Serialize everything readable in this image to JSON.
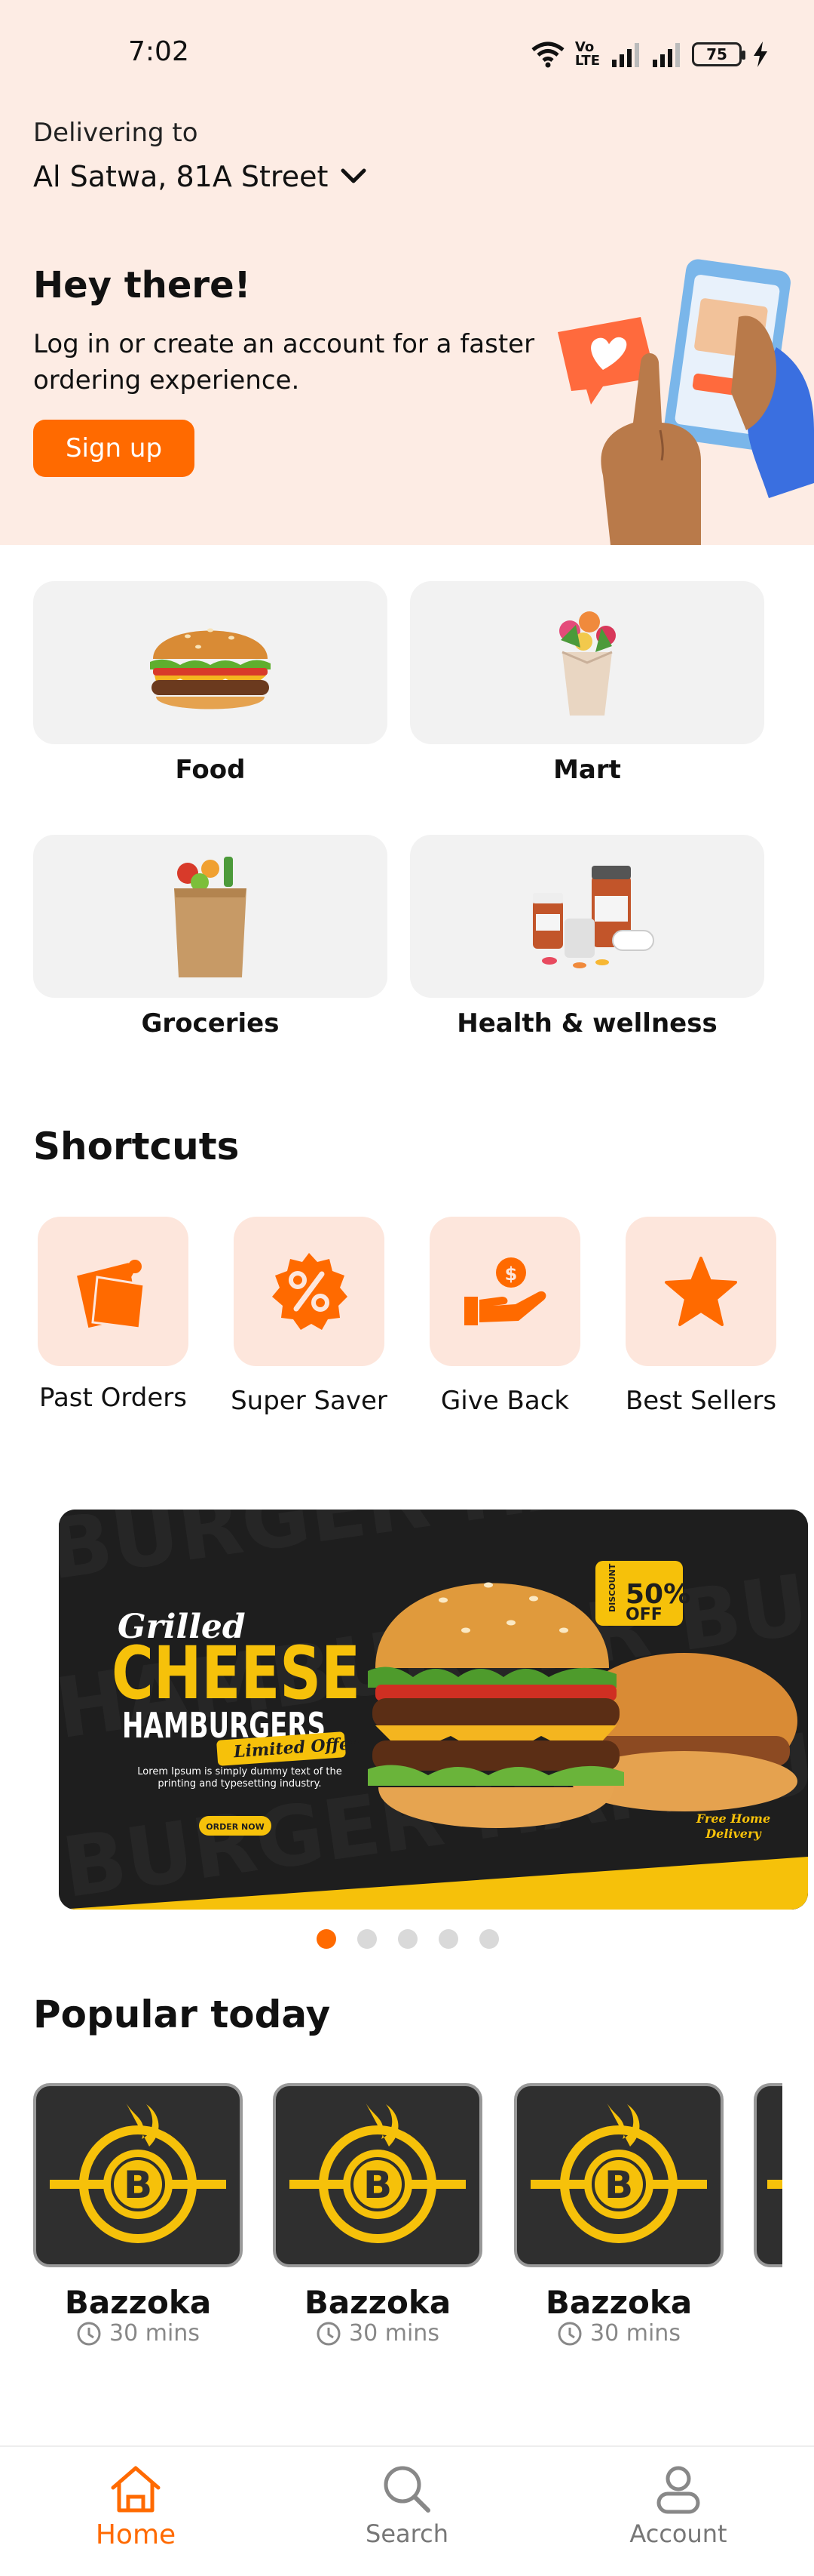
{
  "status_bar": {
    "time": "7:02",
    "network_label": "Vo\nLTE",
    "battery": "75"
  },
  "header": {
    "delivering_label": "Delivering to",
    "location": "Al Satwa, 81A Street"
  },
  "hero": {
    "greeting": "Hey there!",
    "subtitle": "Log in or create an account for a faster ordering experience.",
    "signup_label": "Sign up"
  },
  "categories": [
    {
      "label": "Food",
      "icon": "burger-icon"
    },
    {
      "label": "Mart",
      "icon": "bouquet-icon"
    },
    {
      "label": "Groceries",
      "icon": "grocery-bag-icon"
    },
    {
      "label": "Health & wellness",
      "icon": "medicine-icon"
    }
  ],
  "shortcuts": {
    "title": "Shortcuts",
    "items": [
      {
        "label": "Past Orders",
        "icon": "pinned-note-icon"
      },
      {
        "label": "Super Saver",
        "icon": "discount-badge-icon"
      },
      {
        "label": "Give Back",
        "icon": "donate-hand-icon"
      },
      {
        "label": "Best Sellers",
        "icon": "star-icon"
      }
    ]
  },
  "banner": {
    "script_title": "Grilled",
    "title_main": "CHEESE",
    "title_sub": "HAMBURGERS",
    "ribbon": "Limited Offer",
    "body": "Lorem Ipsum is simply dummy text of the printing and typesetting industry.",
    "cta": "ORDER NOW",
    "offer_value": "50%",
    "offer_unit": "OFF",
    "offer_prefix": "DISCOUNT",
    "delivery_note": "Free Home Delivery",
    "slide_count": 5,
    "active_slide": 1
  },
  "popular": {
    "title": "Popular today",
    "items": [
      {
        "name": "Bazzoka",
        "time": "30 mins",
        "logo_letter": "B"
      },
      {
        "name": "Bazzoka",
        "time": "30 mins",
        "logo_letter": "B"
      },
      {
        "name": "Bazzoka",
        "time": "30 mins",
        "logo_letter": "B"
      }
    ]
  },
  "nav": {
    "home": "Home",
    "search": "Search",
    "account": "Account",
    "active": "home"
  },
  "colors": {
    "accent": "#ff6a00",
    "hero_bg": "#fdece4",
    "tile_bg": "#fde6dc",
    "card_bg": "#f2f2f2",
    "banner_yellow": "#f6c10a"
  }
}
